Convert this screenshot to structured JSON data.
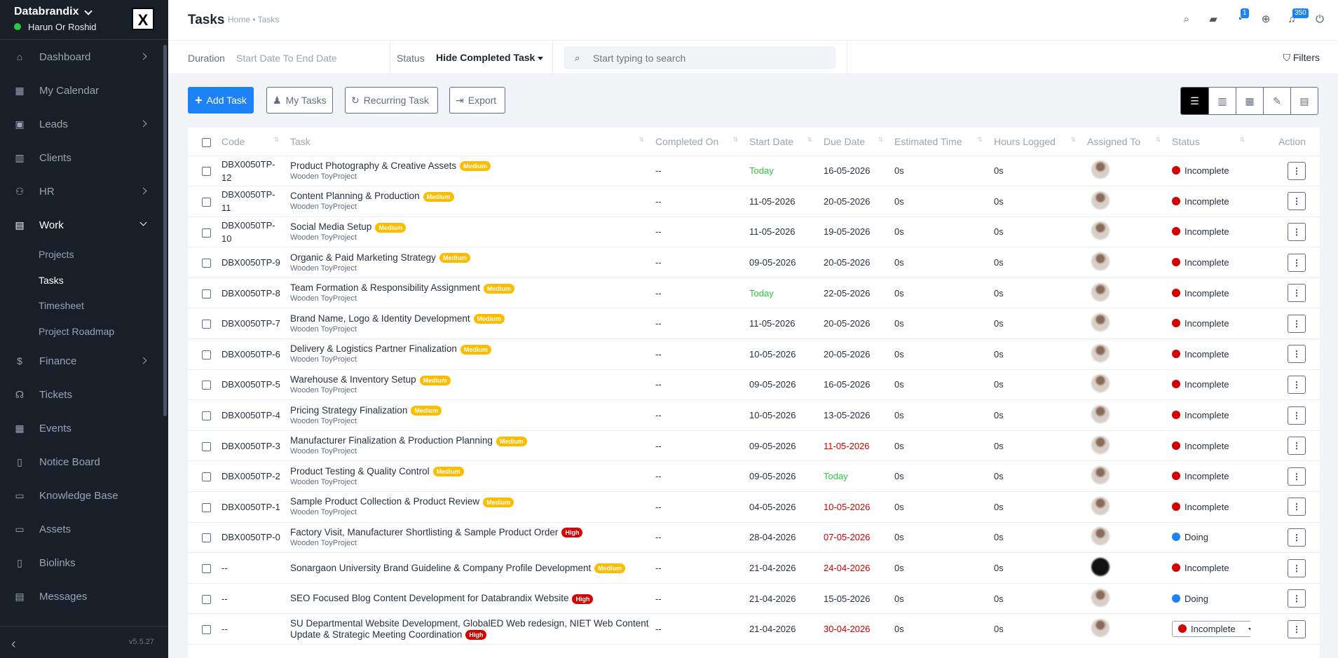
{
  "brand": {
    "name": "Databrandix",
    "user": "Harun Or Roshid",
    "logo": "X"
  },
  "sidebar": {
    "items": [
      {
        "label": "Dashboard",
        "icon": "home-icon",
        "glyph": "⌂",
        "arrow": true
      },
      {
        "label": "My Calendar",
        "icon": "calendar-icon",
        "glyph": "▦",
        "arrow": false
      },
      {
        "label": "Leads",
        "icon": "contact-icon",
        "glyph": "▣",
        "arrow": true
      },
      {
        "label": "Clients",
        "icon": "building-icon",
        "glyph": "▥",
        "arrow": false
      },
      {
        "label": "HR",
        "icon": "people-icon",
        "glyph": "⚇",
        "arrow": true
      },
      {
        "label": "Work",
        "icon": "briefcase-icon",
        "glyph": "▤",
        "arrow": true,
        "open": true
      },
      {
        "label": "Finance",
        "icon": "dollar-icon",
        "glyph": "$",
        "arrow": true
      },
      {
        "label": "Tickets",
        "icon": "headset-icon",
        "glyph": "☊",
        "arrow": false
      },
      {
        "label": "Events",
        "icon": "calendar-event-icon",
        "glyph": "▦",
        "arrow": false
      },
      {
        "label": "Notice Board",
        "icon": "clipboard-icon",
        "glyph": "▯",
        "arrow": false
      },
      {
        "label": "Knowledge Base",
        "icon": "book-icon",
        "glyph": "▭",
        "arrow": false
      },
      {
        "label": "Assets",
        "icon": "monitor-icon",
        "glyph": "▭",
        "arrow": false
      },
      {
        "label": "Biolinks",
        "icon": "phone-icon",
        "glyph": "▯",
        "arrow": false
      },
      {
        "label": "Messages",
        "icon": "chat-icon",
        "glyph": "▤",
        "arrow": false
      }
    ],
    "work_sub": [
      "Projects",
      "Tasks",
      "Timesheet",
      "Project Roadmap"
    ],
    "version": "v5.5.27"
  },
  "header": {
    "title": "Tasks",
    "breadcrumb": "Home • Tasks",
    "badge_clock": "1",
    "badge_bell": "350"
  },
  "filters": {
    "duration_label": "Duration",
    "duration_value": "Start Date To End Date",
    "status_label": "Status",
    "status_value": "Hide Completed Task",
    "search_placeholder": "Start typing to search",
    "filters_label": "Filters"
  },
  "actions": {
    "add": "Add Task",
    "my": "My Tasks",
    "recurring": "Recurring Task",
    "export": "Export"
  },
  "table": {
    "headers": [
      "Code",
      "Task",
      "Completed On",
      "Start Date",
      "Due Date",
      "Estimated Time",
      "Hours Logged",
      "Assigned To",
      "Status",
      "Action"
    ],
    "rows": [
      {
        "code": "DBX0050TP-12",
        "task": "Product Photography & Creative Assets",
        "priority": "Medium",
        "project": "Wooden ToyProject",
        "completed": "--",
        "start": "Today",
        "start_c": "green",
        "due": "16-05-2026",
        "due_c": "",
        "est": "0s",
        "logged": "0s",
        "status": "Incomplete"
      },
      {
        "code": "DBX0050TP-11",
        "task": "Content Planning & Production",
        "priority": "Medium",
        "project": "Wooden ToyProject",
        "completed": "--",
        "start": "11-05-2026",
        "start_c": "",
        "due": "20-05-2026",
        "due_c": "",
        "est": "0s",
        "logged": "0s",
        "status": "Incomplete"
      },
      {
        "code": "DBX0050TP-10",
        "task": "Social Media Setup",
        "priority": "Medium",
        "project": "Wooden ToyProject",
        "completed": "--",
        "start": "11-05-2026",
        "start_c": "",
        "due": "19-05-2026",
        "due_c": "",
        "est": "0s",
        "logged": "0s",
        "status": "Incomplete"
      },
      {
        "code": "DBX0050TP-9",
        "task": "Organic & Paid Marketing Strategy",
        "priority": "Medium",
        "project": "Wooden ToyProject",
        "completed": "--",
        "start": "09-05-2026",
        "start_c": "",
        "due": "20-05-2026",
        "due_c": "",
        "est": "0s",
        "logged": "0s",
        "status": "Incomplete"
      },
      {
        "code": "DBX0050TP-8",
        "task": "Team Formation & Responsibility Assignment",
        "priority": "Medium",
        "project": "Wooden ToyProject",
        "completed": "--",
        "start": "Today",
        "start_c": "green",
        "due": "22-05-2026",
        "due_c": "",
        "est": "0s",
        "logged": "0s",
        "status": "Incomplete"
      },
      {
        "code": "DBX0050TP-7",
        "task": "Brand Name, Logo & Identity Development",
        "priority": "Medium",
        "project": "Wooden ToyProject",
        "completed": "--",
        "start": "11-05-2026",
        "start_c": "",
        "due": "20-05-2026",
        "due_c": "",
        "est": "0s",
        "logged": "0s",
        "status": "Incomplete"
      },
      {
        "code": "DBX0050TP-6",
        "task": "Delivery & Logistics Partner Finalization",
        "priority": "Medium",
        "project": "Wooden ToyProject",
        "completed": "--",
        "start": "10-05-2026",
        "start_c": "",
        "due": "20-05-2026",
        "due_c": "",
        "est": "0s",
        "logged": "0s",
        "status": "Incomplete"
      },
      {
        "code": "DBX0050TP-5",
        "task": "Warehouse & Inventory Setup",
        "priority": "Medium",
        "project": "Wooden ToyProject",
        "completed": "--",
        "start": "09-05-2026",
        "start_c": "",
        "due": "16-05-2026",
        "due_c": "",
        "est": "0s",
        "logged": "0s",
        "status": "Incomplete"
      },
      {
        "code": "DBX0050TP-4",
        "task": "Pricing Strategy Finalization",
        "priority": "Medium",
        "project": "Wooden ToyProject",
        "completed": "--",
        "start": "10-05-2026",
        "start_c": "",
        "due": "13-05-2026",
        "due_c": "",
        "est": "0s",
        "logged": "0s",
        "status": "Incomplete"
      },
      {
        "code": "DBX0050TP-3",
        "task": "Manufacturer Finalization & Production Planning",
        "priority": "Medium",
        "project": "Wooden ToyProject",
        "completed": "--",
        "start": "09-05-2026",
        "start_c": "",
        "due": "11-05-2026",
        "due_c": "red",
        "est": "0s",
        "logged": "0s",
        "status": "Incomplete"
      },
      {
        "code": "DBX0050TP-2",
        "task": "Product Testing & Quality Control",
        "priority": "Medium",
        "project": "Wooden ToyProject",
        "completed": "--",
        "start": "09-05-2026",
        "start_c": "",
        "due": "Today",
        "due_c": "green",
        "est": "0s",
        "logged": "0s",
        "status": "Incomplete"
      },
      {
        "code": "DBX0050TP-1",
        "task": "Sample Product Collection & Product Review",
        "priority": "Medium",
        "project": "Wooden ToyProject",
        "completed": "--",
        "start": "04-05-2026",
        "start_c": "",
        "due": "10-05-2026",
        "due_c": "red",
        "est": "0s",
        "logged": "0s",
        "status": "Incomplete"
      },
      {
        "code": "DBX0050TP-0",
        "task": "Factory Visit, Manufacturer Shortlisting & Sample Product Order",
        "priority": "High",
        "project": "Wooden ToyProject",
        "completed": "--",
        "start": "28-04-2026",
        "start_c": "",
        "due": "07-05-2026",
        "due_c": "red",
        "est": "0s",
        "logged": "0s",
        "status": "Doing"
      },
      {
        "code": "--",
        "task": "Sonargaon University Brand Guideline & Company Profile Development",
        "priority": "Medium",
        "project": "",
        "completed": "--",
        "start": "21-04-2026",
        "start_c": "",
        "due": "24-04-2026",
        "due_c": "red",
        "est": "0s",
        "logged": "0s",
        "status": "Incomplete",
        "avatar": "dark"
      },
      {
        "code": "--",
        "task": "SEO Focused Blog Content Development for Databrandix Website",
        "priority": "High",
        "project": "",
        "completed": "--",
        "start": "21-04-2026",
        "start_c": "",
        "due": "15-05-2026",
        "due_c": "",
        "est": "0s",
        "logged": "0s",
        "status": "Doing"
      },
      {
        "code": "--",
        "task": "SU Departmental Website Development, GlobalED Web redesign, NIET Web Content Update & Strategic Meeting Coordination",
        "priority": "High",
        "project": "",
        "completed": "--",
        "start": "21-04-2026",
        "start_c": "",
        "due": "30-04-2026",
        "due_c": "red",
        "est": "0s",
        "logged": "0s",
        "status": "Incomplete",
        "select": true
      }
    ]
  }
}
